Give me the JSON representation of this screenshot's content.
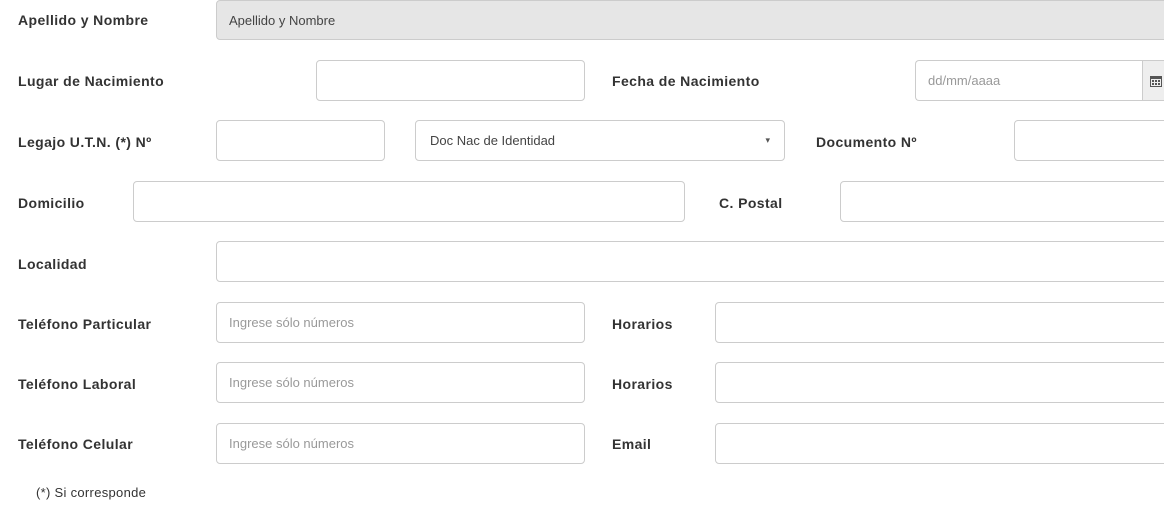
{
  "form": {
    "apellido_nombre": {
      "label": "Apellido y Nombre",
      "value": "Apellido y Nombre"
    },
    "lugar_nacimiento": {
      "label": "Lugar de Nacimiento",
      "value": ""
    },
    "fecha_nacimiento": {
      "label": "Fecha de Nacimiento",
      "placeholder": "dd/mm/aaaa",
      "icon": "calendar-icon"
    },
    "legajo": {
      "label": "Legajo U.T.N. (*) Nº",
      "value": ""
    },
    "tipo_documento": {
      "selected": "Doc Nac de Identidad",
      "caret": "▾"
    },
    "documento": {
      "label": "Documento Nº",
      "value": ""
    },
    "domicilio": {
      "label": "Domicilio",
      "value": ""
    },
    "codigo_postal": {
      "label": "C. Postal",
      "value": ""
    },
    "localidad": {
      "label": "Localidad",
      "value": ""
    },
    "telefono_particular": {
      "label": "Teléfono Particular",
      "placeholder": "Ingrese sólo números"
    },
    "horarios_particular": {
      "label": "Horarios",
      "value": ""
    },
    "telefono_laboral": {
      "label": "Teléfono Laboral",
      "placeholder": "Ingrese sólo números"
    },
    "horarios_laboral": {
      "label": "Horarios",
      "value": ""
    },
    "telefono_celular": {
      "label": "Teléfono Celular",
      "placeholder": "Ingrese sólo números"
    },
    "email": {
      "label": "Email",
      "value": ""
    },
    "footnote": "(*) Si corresponde"
  },
  "colors": {
    "readonly_bg": "#e6e6e6",
    "border": "#cccccc",
    "addon_bg": "#eeeeee"
  }
}
